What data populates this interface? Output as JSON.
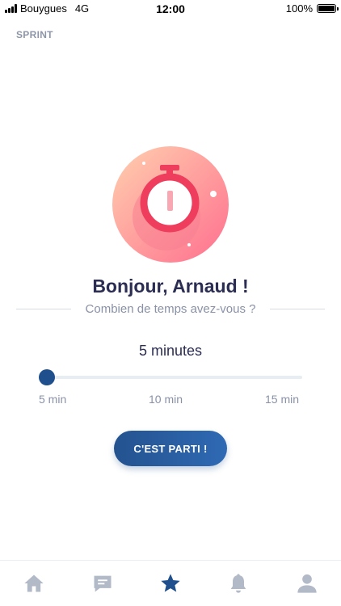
{
  "status_bar": {
    "carrier": "Bouygues",
    "network": "4G",
    "time": "12:00",
    "battery": "100%",
    "battery_level": 1.0
  },
  "header": {
    "section": "SPRINT"
  },
  "illustration": {
    "icon": "stopwatch-icon"
  },
  "main": {
    "greeting": "Bonjour, Arnaud !",
    "question": "Combien de temps avez-vous ?",
    "duration": "5 minutes",
    "slider": {
      "value": 5,
      "min": 5,
      "max": 15,
      "ticks": [
        "5 min",
        "10 min",
        "15 min"
      ]
    },
    "cta": "C'EST PARTI !"
  },
  "bottom_nav": {
    "items": [
      {
        "icon": "home-icon",
        "active": false
      },
      {
        "icon": "chat-icon",
        "active": false
      },
      {
        "icon": "star-icon",
        "active": true
      },
      {
        "icon": "bell-icon",
        "active": false
      },
      {
        "icon": "profile-icon",
        "active": false
      }
    ]
  },
  "colors": {
    "primary": "#1f4f8c",
    "text_dark": "#2b2d52",
    "text_muted": "#8891a7",
    "accent_red": "#ee3d5d",
    "nav_inactive": "#b3bac7"
  }
}
